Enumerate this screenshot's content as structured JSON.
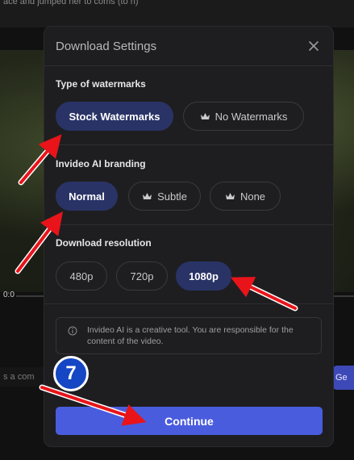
{
  "background": {
    "top_text": "ace and jumped her to coms (to n)",
    "time_text": "0:0",
    "comment_text": "s a com",
    "side_button_text": "Ge"
  },
  "modal": {
    "title": "Download Settings",
    "close_icon": "close-icon",
    "sections": {
      "watermarks": {
        "label": "Type of watermarks",
        "options": [
          "Stock Watermarks",
          "No Watermarks"
        ],
        "selected": "Stock Watermarks"
      },
      "branding": {
        "label": "Invideo AI branding",
        "options": [
          "Normal",
          "Subtle",
          "None"
        ],
        "selected": "Normal"
      },
      "resolution": {
        "label": "Download resolution",
        "options": [
          "480p",
          "720p",
          "1080p"
        ],
        "selected": "1080p"
      }
    },
    "info": {
      "icon": "info-icon",
      "text": "Invideo AI is a creative tool. You are responsible for the content of the video."
    },
    "continue_label": "Continue"
  },
  "annotations": {
    "step_number": "7",
    "arrow_color": "#e8141a",
    "badge_color": "#1546c4"
  },
  "colors": {
    "accent": "#4a5cde",
    "selected_pill": "#2a3366",
    "modal_bg": "#1e1e20"
  }
}
